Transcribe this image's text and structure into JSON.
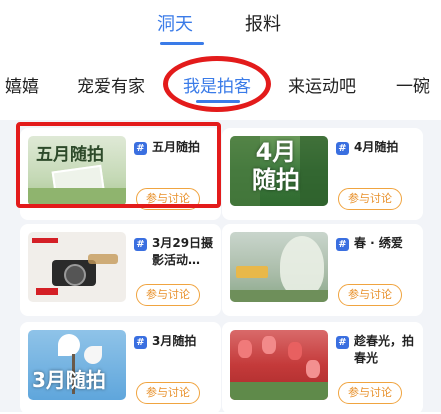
{
  "top_tabs": [
    {
      "label": "洞天",
      "active": true
    },
    {
      "label": "报料",
      "active": false
    }
  ],
  "categories": [
    {
      "label": "嬉嬉",
      "active": false
    },
    {
      "label": "宠爱有家",
      "active": false
    },
    {
      "label": "我是拍客",
      "active": true
    },
    {
      "label": "来运动吧",
      "active": false
    },
    {
      "label": "一碗",
      "active": false
    }
  ],
  "cards": [
    {
      "title": "五月随拍",
      "button": "参与讨论",
      "thumb_text": "五月随拍",
      "thumb_icon": "spring-meadow-image"
    },
    {
      "title": "4月随拍",
      "button": "参与讨论",
      "thumb_text": "4月\n随拍",
      "thumb_icon": "green-park-image"
    },
    {
      "title": "3月29日摄影活动…",
      "button": "参与讨论",
      "thumb_text": "",
      "thumb_icon": "camera-promo-image"
    },
    {
      "title": "春 · 绣爱",
      "button": "参与讨论",
      "thumb_text": "",
      "thumb_icon": "blossom-tree-image"
    },
    {
      "title": "3月随拍",
      "button": "参与讨论",
      "thumb_text": "3月随拍",
      "thumb_icon": "magnolia-image"
    },
    {
      "title": "趁春光，拍春光",
      "button": "参与讨论",
      "thumb_text": "",
      "thumb_icon": "tulip-field-image"
    }
  ],
  "colors": {
    "accent": "#3a7be8",
    "button": "#e8902a",
    "highlight": "#e31b1b"
  }
}
